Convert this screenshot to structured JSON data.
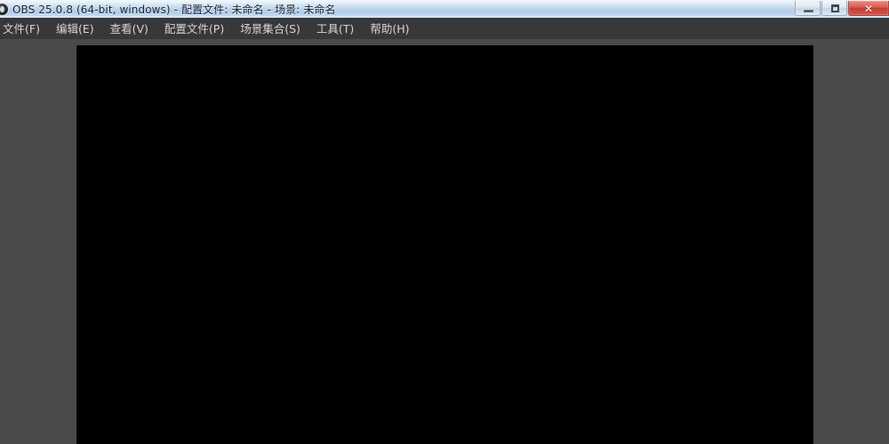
{
  "window": {
    "app_icon": "obs-logo-icon",
    "title": "OBS 25.0.8 (64-bit, windows) - 配置文件: 未命名 - 场景: 未命名",
    "controls": {
      "minimize": {
        "name": "minimize-button",
        "glyph": "—"
      },
      "maximize": {
        "name": "maximize-button",
        "glyph": "▢"
      },
      "close": {
        "name": "close-button",
        "glyph": "✕"
      }
    }
  },
  "menubar": {
    "items": [
      {
        "label": "文件(F)",
        "name": "menu-file"
      },
      {
        "label": "编辑(E)",
        "name": "menu-edit"
      },
      {
        "label": "查看(V)",
        "name": "menu-view"
      },
      {
        "label": "配置文件(P)",
        "name": "menu-profile"
      },
      {
        "label": "场景集合(S)",
        "name": "menu-scene-collection"
      },
      {
        "label": "工具(T)",
        "name": "menu-tools"
      },
      {
        "label": "帮助(H)",
        "name": "menu-help"
      }
    ]
  },
  "preview": {
    "name": "preview-canvas",
    "content": "",
    "background_color": "#000000"
  },
  "colors": {
    "titlebar": "#bdd4ec",
    "menubar": "#383838",
    "panel": "#4b4b4b",
    "preview": "#000000",
    "close_button": "#c63f33",
    "menu_text": "#d6d6d6",
    "title_text": "#16243a"
  }
}
